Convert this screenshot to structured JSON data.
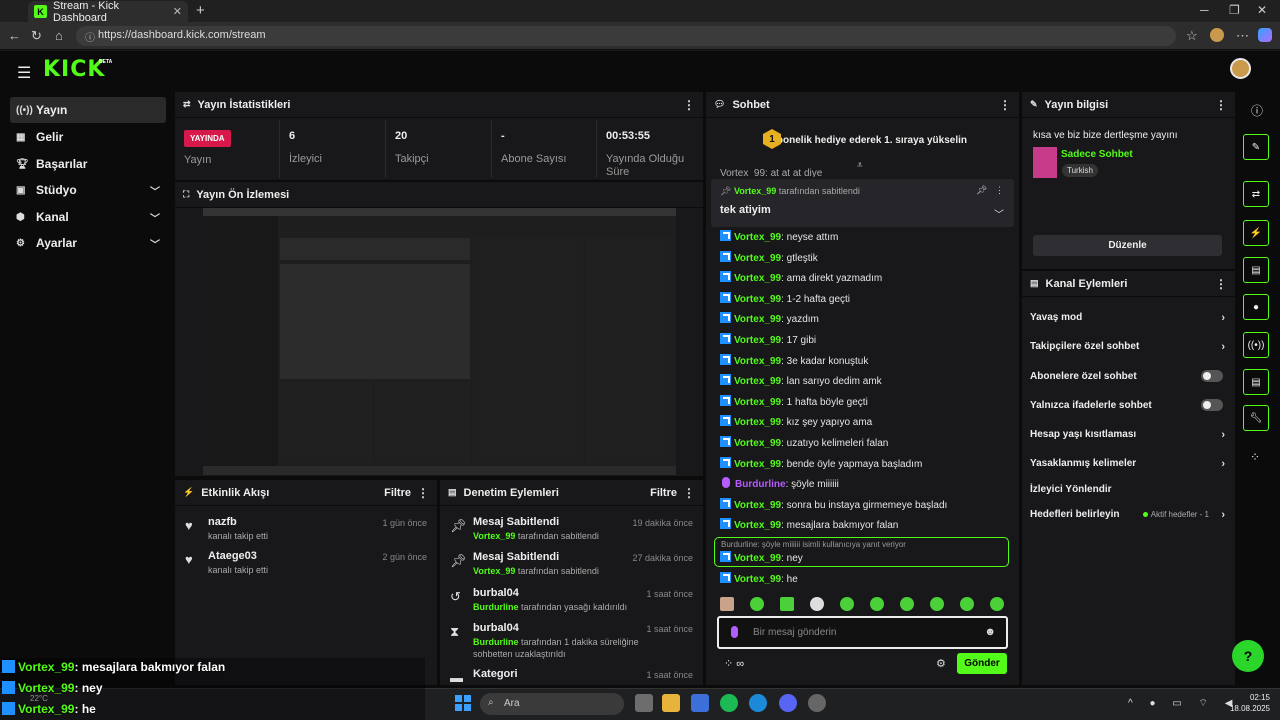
{
  "browser": {
    "tab_title": "Stream - Kick Dashboard",
    "url": "https://dashboard.kick.com/stream"
  },
  "header": {
    "logo": "KICK",
    "beta": "BETA"
  },
  "sidebar": {
    "items": [
      {
        "label": "Yayın",
        "icon": "broadcast-icon"
      },
      {
        "label": "Gelir",
        "icon": "revenue-icon"
      },
      {
        "label": "Başarılar",
        "icon": "trophy-icon"
      },
      {
        "label": "Stüdyo",
        "icon": "studio-icon"
      },
      {
        "label": "Kanal",
        "icon": "channel-icon"
      },
      {
        "label": "Ayarlar",
        "icon": "gear-icon"
      }
    ]
  },
  "stats": {
    "title": "Yayın İstatistikleri",
    "live_badge": "YAYINDA",
    "live_label": "Yayın",
    "viewers_value": "6",
    "viewers_label": "İzleyici",
    "followers_value": "20",
    "followers_label": "Takipçi",
    "subs_value": "-",
    "subs_label": "Abone Sayısı",
    "duration_value": "00:53:55",
    "duration_label": "Yayında Olduğu Süre"
  },
  "preview": {
    "title": "Yayın Ön İzlemesi"
  },
  "activity": {
    "title": "Etkinlik Akışı",
    "filter": "Filtre",
    "events": [
      {
        "name": "nazfb",
        "desc": "kanalı takip etti",
        "time": "1 gün önce"
      },
      {
        "name": "Ataege03",
        "desc": "kanalı takip etti",
        "time": "2 gün önce"
      }
    ]
  },
  "moderation": {
    "title": "Denetim Eylemleri",
    "filter": "Filtre",
    "events": [
      {
        "title": "Mesaj Sabitlendi",
        "user": "Vortex_99",
        "desc": "tarafından sabitlendi",
        "time": "19 dakika önce"
      },
      {
        "title": "Mesaj Sabitlendi",
        "user": "Vortex_99",
        "desc": "tarafından sabitlendi",
        "time": "27 dakika önce"
      },
      {
        "title": "burbal04",
        "user": "Burdurline",
        "desc": "tarafından yasağı kaldırıldı",
        "time": "1 saat önce"
      },
      {
        "title": "burbal04",
        "user": "Burdurline",
        "desc": "tarafından 1 dakika süreliğine sohbetten uzaklaştırıldı",
        "time": "1 saat önce"
      },
      {
        "title": "Kategori",
        "user": "",
        "desc": "",
        "time": "1 saat önce"
      }
    ]
  },
  "chat": {
    "title": "Sohbet",
    "sub_goal": "1 abonelik hediye ederek 1. sıraya yükselin",
    "sub_rank": "1",
    "pinned_by_user": "Vortex_99",
    "pinned_by_text": "tarafından sabitlendi",
    "pinned_text": "tek atiyim",
    "partial": "Vortex_99: at at at diye",
    "messages": [
      {
        "user": "Vortex_99",
        "text": "neyse attım"
      },
      {
        "user": "Vortex_99",
        "text": "gtleştik"
      },
      {
        "user": "Vortex_99",
        "text": "ama direkt yazmadım"
      },
      {
        "user": "Vortex_99",
        "text": "1-2 hafta geçti"
      },
      {
        "user": "Vortex_99",
        "text": "yazdım"
      },
      {
        "user": "Vortex_99",
        "text": "17 gibi"
      },
      {
        "user": "Vortex_99",
        "text": "3e kadar konuştuk"
      },
      {
        "user": "Vortex_99",
        "text": "lan sarıyo dedim amk"
      },
      {
        "user": "Vortex_99",
        "text": "1 hafta böyle geçti"
      },
      {
        "user": "Vortex_99",
        "text": "kız şey yapıyo ama"
      },
      {
        "user": "Vortex_99",
        "text": "uzatıyo kelimeleri falan"
      },
      {
        "user": "Vortex_99",
        "text": "bende öyle yapmaya başladım"
      },
      {
        "user": "Burdurline",
        "text": "şöyle miiiiii"
      },
      {
        "user": "Vortex_99",
        "text": "sonra bu instaya girmemeye başladı"
      },
      {
        "user": "Vortex_99",
        "text": "mesajlara bakmıyor falan"
      }
    ],
    "reply_quote": "Burdurline: şöyle miiiiii isimli kullanıcıya yanıt veriyor",
    "reply_user": "Vortex_99",
    "reply_text": "ney",
    "last_user": "Vortex_99",
    "last_text": "he",
    "input_placeholder": "Bir mesaj gönderin",
    "send": "Gönder"
  },
  "stream_info": {
    "title": "Yayın bilgisi",
    "stream_title": "kısa ve biz bize dertleşme yayını",
    "category": "Sadece Sohbet",
    "language": "Turkish",
    "edit": "Düzenle"
  },
  "channel_actions": {
    "title": "Kanal Eylemleri",
    "slow": "Yavaş mod",
    "followers_only": "Takipçilere özel sohbet",
    "subs_only": "Abonelere özel sohbet",
    "emotes_only": "Yalnızca ifadelerle sohbet",
    "age": "Hesap yaşı kısıtlaması",
    "banned_words": "Yasaklanmış kelimeler",
    "redirect": "İzleyici Yönlendir",
    "goals": "Hedefleri belirleyin",
    "goals_status": "Aktif hedefler - 1"
  },
  "overlay": [
    {
      "user": "Vortex_99",
      "text": ": mesajlara bakmıyor falan"
    },
    {
      "user": "Vortex_99",
      "text": ": ney"
    },
    {
      "user": "Vortex_99",
      "text": ": he"
    }
  ],
  "taskbar": {
    "search": "Ara",
    "time": "02:15",
    "date": "18.08.2025",
    "weather": "22°C"
  },
  "colors": {
    "accent": "#53fc18",
    "live": "#d6194a",
    "kick_badge": "#1e90ff",
    "mod_user": "#b75cff"
  }
}
